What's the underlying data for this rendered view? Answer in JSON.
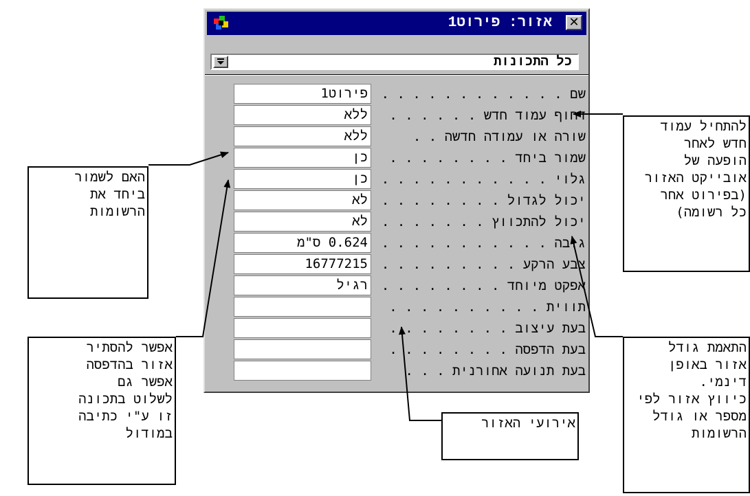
{
  "window": {
    "title": "אזור: פירוט1",
    "section_selector": "כל התכונות"
  },
  "properties": [
    {
      "label": "שם . . . . . . . . . . . . . . .",
      "value": "פירוט1"
    },
    {
      "label": "דחוף עמוד חדש . . . . . . .",
      "value": "ללא"
    },
    {
      "label": "שורה או עמודה חדשה . .",
      "value": "ללא"
    },
    {
      "label": "שמור ביחד . . . . . . . . .",
      "value": "כן"
    },
    {
      "label": "גלוי . . . . . . . . . . . . . .",
      "value": "כן"
    },
    {
      "label": "יכול לגדול . . . . . . . . .",
      "value": "לא"
    },
    {
      "label": "יכול להתכווץ . . . . . . .",
      "value": "לא"
    },
    {
      "label": "גובה . . . . . . . . . . . . . .",
      "value": "0.624 ס\"מ"
    },
    {
      "label": "צבע הרקע . . . . . . . . . .",
      "value": "16777215"
    },
    {
      "label": "אפקט מיוחד . . . . . . . . .",
      "value": "רגיל"
    },
    {
      "label": "תווית . . . . . . . . . . . . .",
      "value": ""
    },
    {
      "label": "בעת עיצוב . . . . . . . . .",
      "value": ""
    },
    {
      "label": "בעת הדפסה . . . . . . . .",
      "value": ""
    },
    {
      "label": "בעת תנועה אחורנית . . .",
      "value": ""
    }
  ],
  "callouts": {
    "new_page": [
      "להתחיל עמוד",
      "חדש לאחר",
      "הופעה של",
      "אובייקט האזור",
      "(בפירוט אחר",
      "כל רשומה)"
    ],
    "keep_together": [
      "האם לשמור",
      "ביחד את",
      "הרשומות"
    ],
    "can_shrink": [
      "התאמת גודל",
      "אזור באופן",
      "דינמי.",
      "כיווץ אזור לפי",
      "מספר או גודל",
      "הרשומות"
    ],
    "hide_print": [
      "אפשר להסתיר",
      "אזור בהדפסה",
      "אפשר גם",
      "לשלוט בתכונה",
      "זו ע\"י כתיבה",
      "במודול"
    ],
    "events": [
      "אירועי האזור"
    ]
  }
}
